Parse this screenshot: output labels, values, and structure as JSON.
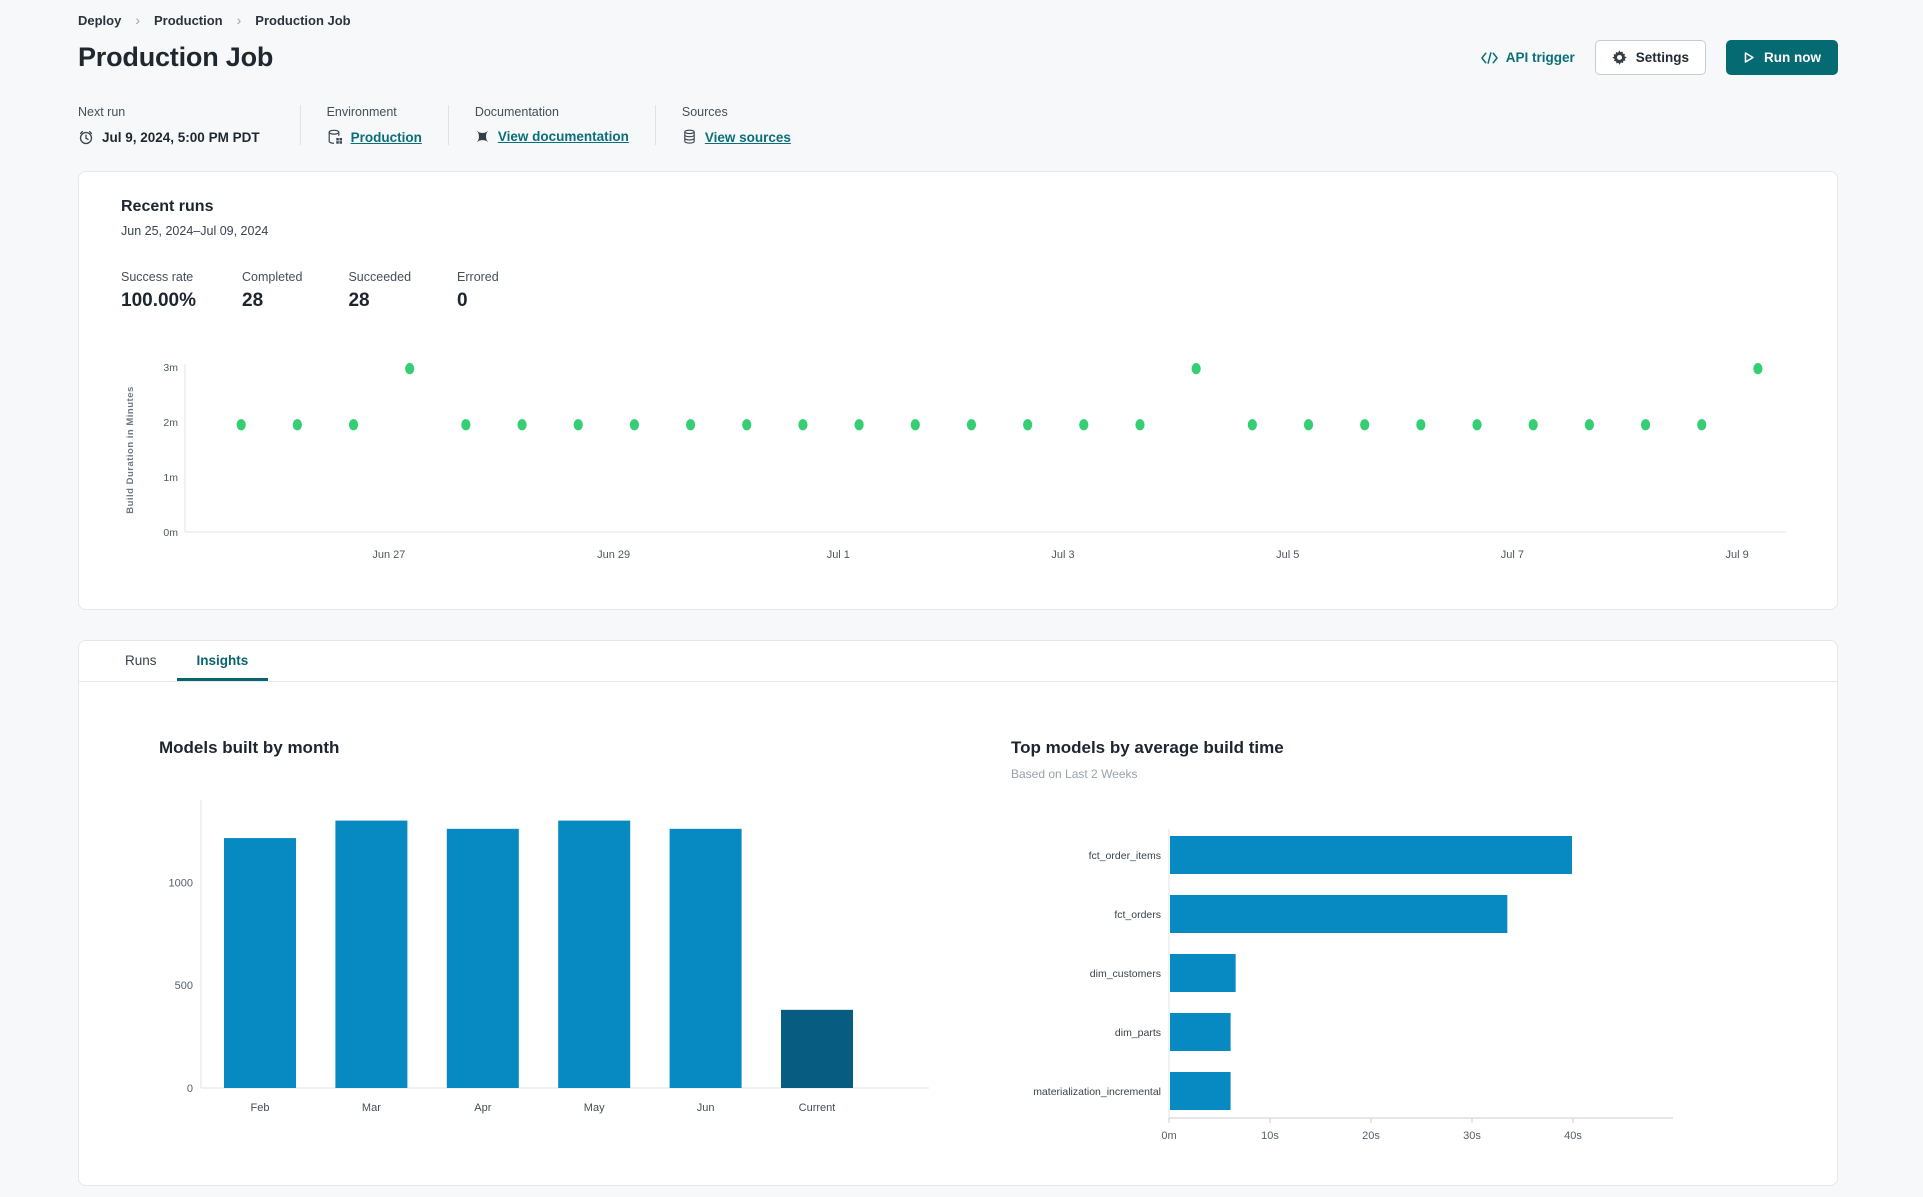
{
  "breadcrumb": {
    "separator": "›",
    "items": [
      "Deploy",
      "Production",
      "Production Job"
    ]
  },
  "header": {
    "title": "Production Job",
    "actions": {
      "api_trigger": "API trigger",
      "settings": "Settings",
      "run_now": "Run now"
    }
  },
  "info_bar": {
    "columns": [
      {
        "label": "Next run",
        "value": "Jul 9, 2024, 5:00 PM PDT",
        "icon": "clock-icon",
        "link": false
      },
      {
        "label": "Environment",
        "value": "Production",
        "icon": "database-gear-icon",
        "link": true
      },
      {
        "label": "Documentation",
        "value": "View documentation",
        "icon": "dbt-logo-icon",
        "link": true
      },
      {
        "label": "Sources",
        "value": "View sources",
        "icon": "database-icon",
        "link": true
      }
    ]
  },
  "recent_runs": {
    "title": "Recent runs",
    "date_range": "Jun 25, 2024–Jul 09, 2024",
    "stats": [
      {
        "label": "Success rate",
        "value": "100.00%"
      },
      {
        "label": "Completed",
        "value": "28"
      },
      {
        "label": "Succeeded",
        "value": "28"
      },
      {
        "label": "Errored",
        "value": "0"
      }
    ]
  },
  "tabs": {
    "items": [
      {
        "label": "Runs",
        "active": false
      },
      {
        "label": "Insights",
        "active": true
      }
    ]
  },
  "insights": {
    "models_by_month_title": "Models built by month",
    "top_models_title": "Top models by average build time",
    "top_models_subtitle": "Based on Last 2 Weeks"
  },
  "chart_data": [
    {
      "type": "scatter",
      "name": "build-duration-by-run",
      "ylabel": "Build Duration in Minutes",
      "point_color": "#35ce73",
      "ylim": [
        0,
        3.15
      ],
      "xlim": [
        -1,
        27.5
      ],
      "y_ticks": [
        {
          "v": 0,
          "label": "0m"
        },
        {
          "v": 1,
          "label": "1m"
        },
        {
          "v": 2,
          "label": "2m"
        },
        {
          "v": 3,
          "label": "3m"
        }
      ],
      "x_tick_labels": [
        "Jun 27",
        "Jun 29",
        "Jul 1",
        "Jul 3",
        "Jul 5",
        "Jul 7",
        "Jul 9"
      ],
      "x_tick_positions": [
        2.63,
        6.63,
        10.63,
        14.63,
        18.63,
        22.63,
        26.63
      ],
      "values": [
        1.95,
        1.95,
        1.95,
        2.97,
        1.95,
        1.95,
        1.95,
        1.95,
        1.95,
        1.95,
        1.95,
        1.95,
        1.95,
        1.95,
        1.95,
        1.95,
        1.95,
        2.97,
        1.95,
        1.95,
        1.95,
        1.95,
        1.95,
        1.95,
        1.95,
        1.95,
        1.95,
        2.97
      ]
    },
    {
      "type": "bar",
      "name": "models-built-by-month",
      "title": "Models built by month",
      "categories": [
        "Feb",
        "Mar",
        "Apr",
        "May",
        "Jun",
        "Current"
      ],
      "values": [
        1215,
        1300,
        1260,
        1300,
        1260,
        380
      ],
      "bar_colors": [
        "#0789c2",
        "#0789c2",
        "#0789c2",
        "#0789c2",
        "#0789c2",
        "#065d81"
      ],
      "y_ticks": [
        {
          "v": 0,
          "label": "0"
        },
        {
          "v": 500,
          "label": "500"
        },
        {
          "v": 1000,
          "label": "1000"
        }
      ],
      "ylim": [
        0,
        1400
      ]
    },
    {
      "type": "horizontal_bar",
      "name": "top-models-by-average-build-time",
      "title": "Top models by average build time",
      "subtitle": "Based on Last 2 Weeks",
      "categories": [
        "fct_order_items",
        "fct_orders",
        "dim_customers",
        "dim_parts",
        "materialization_incremental"
      ],
      "values_seconds": [
        39.8,
        33.4,
        6.5,
        6.0,
        6.0
      ],
      "x_ticks": [
        {
          "v": 0,
          "label": "0m"
        },
        {
          "v": 10,
          "label": "10s"
        },
        {
          "v": 20,
          "label": "20s"
        },
        {
          "v": 30,
          "label": "30s"
        },
        {
          "v": 40,
          "label": "40s"
        }
      ],
      "xlim": [
        0,
        43
      ],
      "bar_color": "#0789c2"
    }
  ],
  "colors": {
    "accent_teal": "#066a72",
    "link_teal": "#0b6f79",
    "bar_blue": "#0789c2",
    "bar_dark_blue": "#065d81",
    "dot_green": "#35ce73",
    "page_background": "#f7f8f9"
  }
}
